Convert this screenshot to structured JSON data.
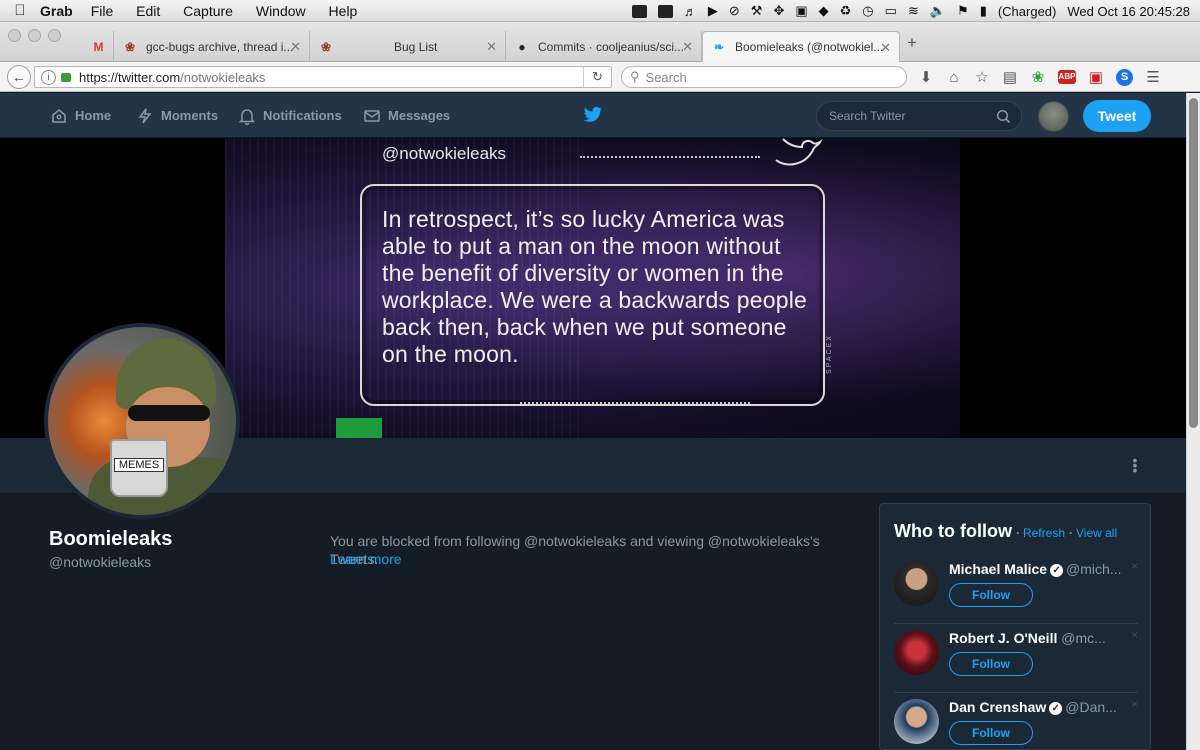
{
  "menubar": {
    "app": "Grab",
    "items": [
      "File",
      "Edit",
      "Capture",
      "Window",
      "Help"
    ],
    "battery": "(Charged)",
    "datetime": "Wed Oct 16  20:45:28"
  },
  "tabs": [
    {
      "title": "",
      "icon": "gmail-icon"
    },
    {
      "title": "gcc-bugs archive, thread i...",
      "icon": "bug-icon"
    },
    {
      "title": "Bug List",
      "icon": "bug-icon"
    },
    {
      "title": "Commits · cooljeanius/sci...",
      "icon": "github-icon"
    },
    {
      "title": "Boomieleaks (@notwokiel...",
      "icon": "twitter-icon"
    }
  ],
  "address": {
    "protocol": "https://",
    "host": "twitter.com",
    "path": "/notwokieleaks",
    "search_placeholder": "Search"
  },
  "twitter_nav": {
    "home": "Home",
    "moments": "Moments",
    "notifications": "Notifications",
    "messages": "Messages",
    "search_placeholder": "Search Twitter",
    "tweet_button": "Tweet"
  },
  "banner": {
    "handle": "@notwokieleaks",
    "quote": "In retrospect, it’s so lucky America was able to put a man on the moon without the benefit of diversity or women in the workplace. We were a backwards people back then, back when we put someone on the moon.",
    "watermark": "SPACEX"
  },
  "profile": {
    "name": "Boomieleaks",
    "handle": "@notwokieleaks",
    "mug_text": "MEMES",
    "blocked_text": "You are blocked from following @notwokieleaks and viewing @notwokieleaks's Tweets.",
    "learn_more": "Learn more"
  },
  "who_to_follow": {
    "title": "Who to follow",
    "refresh": "Refresh",
    "view_all": "View all",
    "people": [
      {
        "name": "Michael Malice",
        "handle": "@mich...",
        "follow": "Follow",
        "close": "×"
      },
      {
        "name": "Robert J. O'Neill",
        "handle": "@mc...",
        "follow": "Follow",
        "close": "×"
      },
      {
        "name": "Dan Crenshaw",
        "handle": "@Dan...",
        "follow": "Follow",
        "close": "×"
      }
    ]
  },
  "colors": {
    "twitter_blue": "#1da1f2",
    "nav_bg": "#243447",
    "page_bg": "#141d26",
    "panel_bg": "#1b2836"
  }
}
